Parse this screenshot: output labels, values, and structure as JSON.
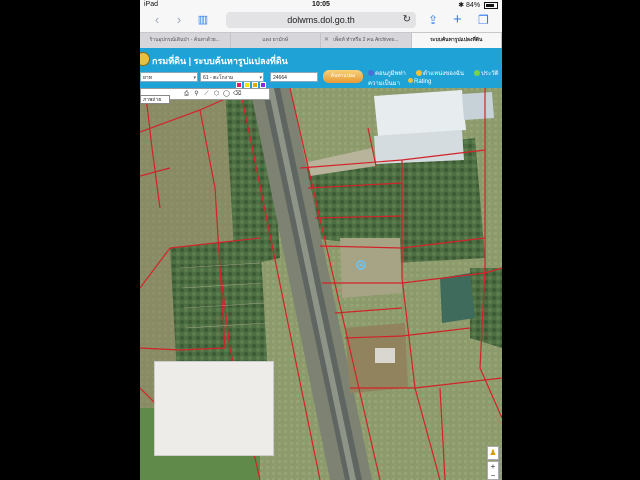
{
  "status_bar": {
    "device": "iPad",
    "time": "10:05",
    "battery": "84%"
  },
  "browser": {
    "url": "dolwms.dol.go.th",
    "tabs": [
      {
        "label": "ร้านอุปกรณ์เดินป่า - ค้นหาด้วย...",
        "active": false
      },
      {
        "label": "แดง ยามักษ์",
        "active": false
      },
      {
        "label": "เพ็ดท์ ทำหรือ 2 คน Archives...",
        "active": false
      },
      {
        "label": "ระบบค้นหารูปแปลงที่ดิน",
        "active": true
      }
    ]
  },
  "site": {
    "title": "กรมที่ดิน | ระบบค้นหารูปแปลงที่ดิน",
    "province_value": "ยาท",
    "district_value": "61 - ตะโกงาม",
    "parcel_value": "24664",
    "search_label": "ค้นหาแปลง",
    "links": {
      "manual": "คอนภูมิพท่า",
      "location": "ตำแหน่งของฉัน",
      "history": "ประวัติ",
      "thanks": "ความเป็นมา",
      "rating": "Rating"
    }
  },
  "map": {
    "layer_value": "ภาพถ่าย",
    "swatch_colors": [
      "#e6196c",
      "#f2e500",
      "#e7a900",
      "#8a2be2"
    ]
  }
}
